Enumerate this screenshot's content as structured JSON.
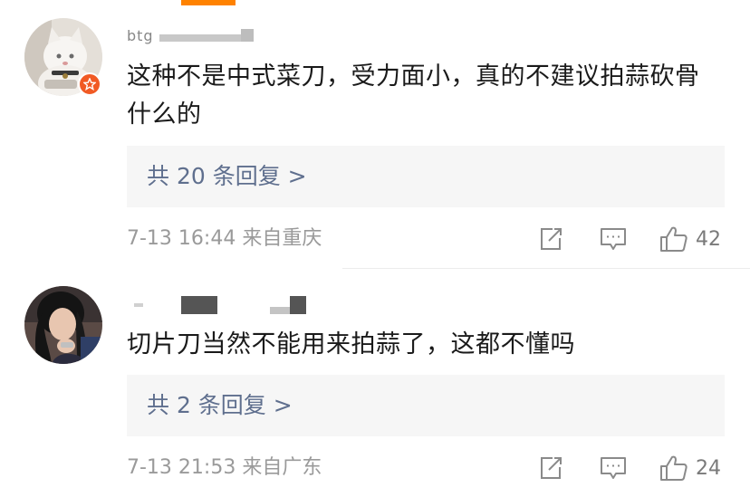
{
  "comments": [
    {
      "user_name": "btg",
      "text": "这种不是中式菜刀，受力面小，真的不建议拍蒜砍骨什么的",
      "reply_label": "共 20 条回复 >",
      "time": "7-13 16:44",
      "location": "来自重庆",
      "likes": "42"
    },
    {
      "user_name": "",
      "text": "切片刀当然不能用来拍蒜了，这都不懂吗",
      "reply_label": "共 2 条回复 >",
      "time": "7-13 21:53",
      "location": "来自广东",
      "likes": "24"
    }
  ],
  "icons": {
    "share": "share-icon",
    "comment": "comment-icon",
    "like": "thumbs-up-icon",
    "badge": "vip-badge-icon"
  },
  "colors": {
    "accent": "#ff8200",
    "link": "#5f6f8e",
    "muted": "#9a9a9a",
    "badge": "#f15a24"
  }
}
